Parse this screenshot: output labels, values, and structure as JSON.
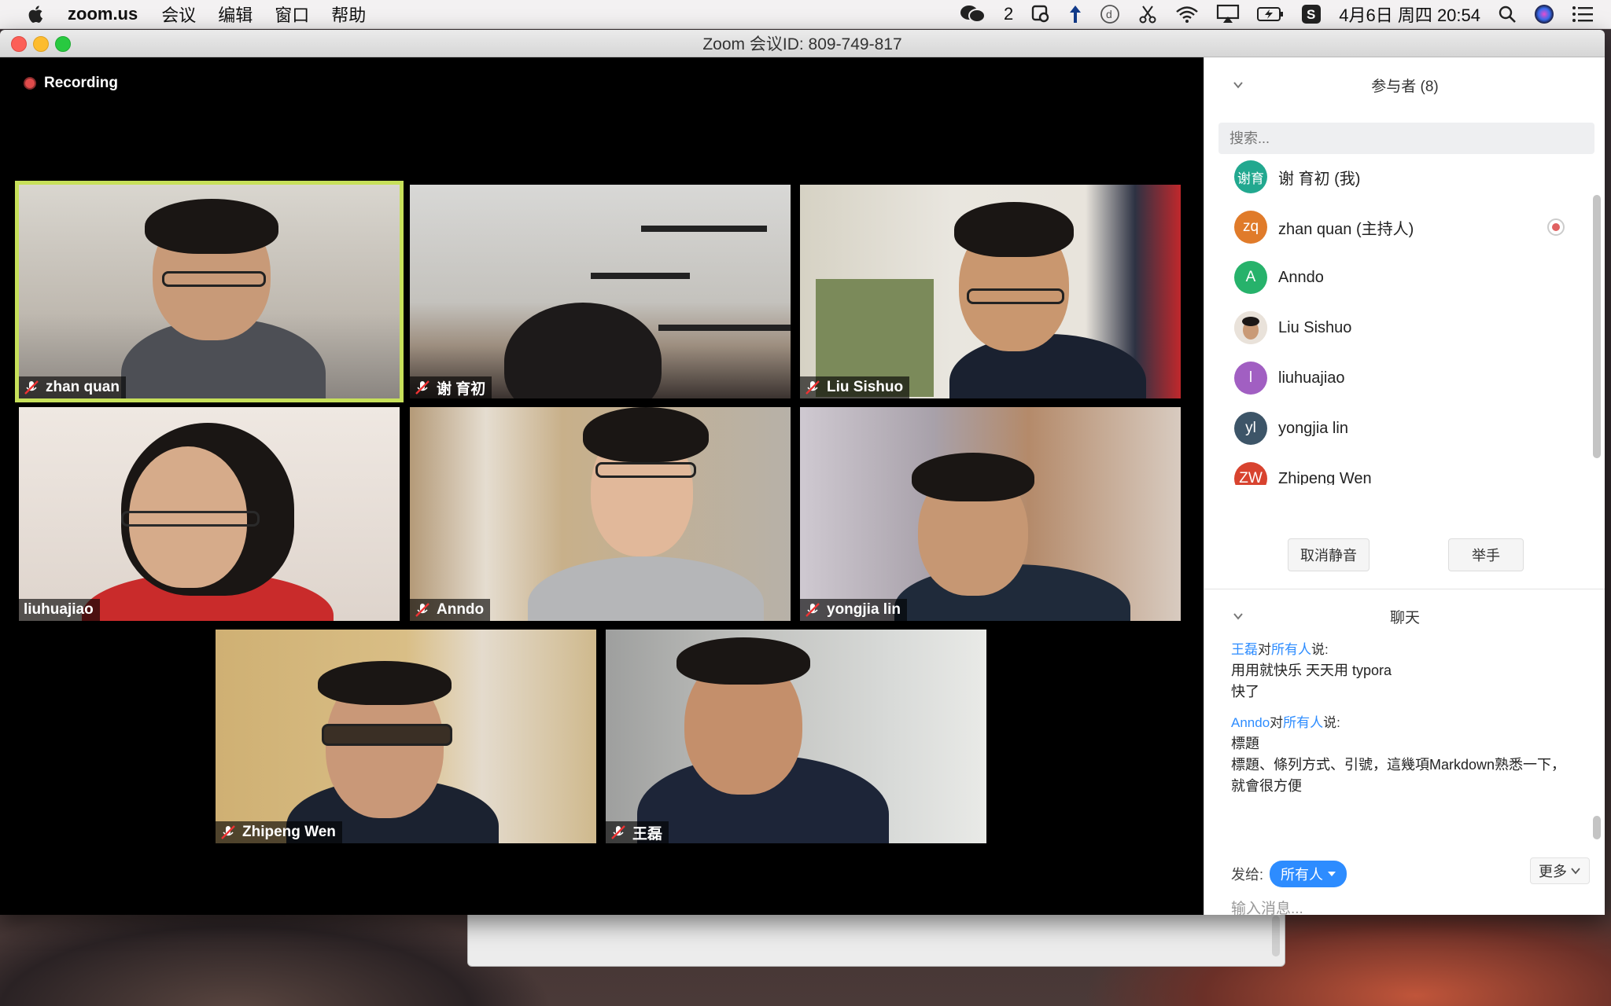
{
  "menubar": {
    "app_name": "zoom.us",
    "menus": [
      "会议",
      "编辑",
      "窗口",
      "帮助"
    ],
    "wechat_count": "2",
    "date_time": "4月6日 周四  20:54"
  },
  "window": {
    "title": "Zoom 会议ID: 809-749-817"
  },
  "recording": {
    "label": "Recording"
  },
  "videos": [
    {
      "name": "zhan quan",
      "muted": true,
      "active": true
    },
    {
      "name": "谢 育初",
      "muted": true,
      "active": false
    },
    {
      "name": "Liu Sishuo",
      "muted": true,
      "active": false
    },
    {
      "name": "liuhuajiao",
      "muted": false,
      "active": false
    },
    {
      "name": "Anndo",
      "muted": true,
      "active": false
    },
    {
      "name": "yongjia lin",
      "muted": true,
      "active": false
    },
    {
      "name": "Zhipeng Wen",
      "muted": true,
      "active": false
    },
    {
      "name": "王磊",
      "muted": true,
      "active": false
    }
  ],
  "participants": {
    "header": "参与者 (8)",
    "search_placeholder": "搜索...",
    "list": [
      {
        "initials": "谢育",
        "name": "谢 育初 (我)",
        "color": "#22a88f"
      },
      {
        "initials": "zq",
        "name": "zhan quan (主持人)",
        "color": "#e07b2a"
      },
      {
        "initials": "A",
        "name": "Anndo",
        "color": "#27b26b"
      },
      {
        "initials": "",
        "name": "Liu Sishuo",
        "color": "#b7a89a"
      },
      {
        "initials": "l",
        "name": "liuhuajiao",
        "color": "#a15fc2"
      },
      {
        "initials": "yl",
        "name": "yongjia lin",
        "color": "#3d5568"
      },
      {
        "initials": "ZW",
        "name": "Zhipeng Wen",
        "color": "#d8432f"
      }
    ],
    "unmute_label": "取消静音",
    "raise_hand_label": "举手"
  },
  "chat": {
    "header": "聊天",
    "messages": [
      {
        "from": "王磊",
        "to_word": "对",
        "to": "所有人",
        "said": "说:",
        "lines": [
          "用用就快乐  天天用 typora",
          "快了"
        ]
      },
      {
        "from": "Anndo",
        "to_word": "对",
        "to": "所有人",
        "said": "说:",
        "lines": [
          "標題",
          "標題、條列方式、引號，這幾項Markdown熟悉一下，就會很方便"
        ]
      }
    ],
    "send_to_label": "发给:",
    "recipient": "所有人",
    "more_label": "更多",
    "input_placeholder": "输入消息..."
  }
}
